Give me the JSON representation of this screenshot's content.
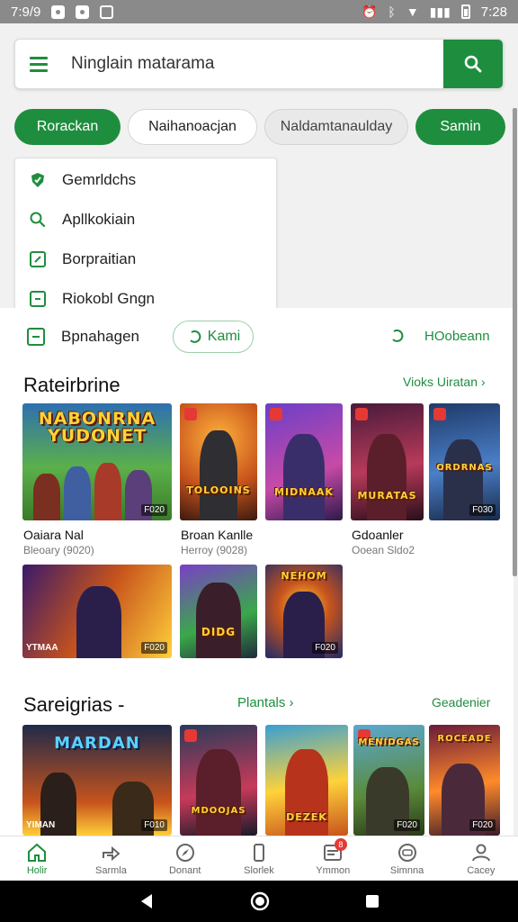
{
  "status_bar": {
    "time_left": "7:9/9",
    "time_right": "7:28"
  },
  "search": {
    "placeholder": "Ninglain matarama"
  },
  "chips": [
    {
      "label": "Rorackan",
      "style": "green"
    },
    {
      "label": "Naihanoacjan",
      "style": "outline"
    },
    {
      "label": "Naldamtanaulday",
      "style": "grey"
    },
    {
      "label": "Samin",
      "style": "green"
    }
  ],
  "dropdown": {
    "items": [
      {
        "label": "Gemrldchs",
        "icon": "shield-icon"
      },
      {
        "label": "Apllkokiain",
        "icon": "search-icon"
      },
      {
        "label": "Borpraitian",
        "icon": "edit-box-icon"
      },
      {
        "label": "Riokobl Gngn",
        "icon": "square-icon"
      }
    ]
  },
  "row1": {
    "label": "Bpnahagen",
    "pill": "Kami",
    "right_link": "HOobeann"
  },
  "section1": {
    "title": "Rateirbrine",
    "link": "Vioks Uiratan",
    "games_row1": [
      {
        "art_title": "NABONRNA\nYUDONET",
        "badge": "F020",
        "name": "Oaiara Nal",
        "sub": "Bleoary (9020)"
      },
      {
        "art_title": "TOLOOINS",
        "badge": "",
        "name": "Broan Kanlle",
        "sub": "Herroy (9028)"
      },
      {
        "art_title": "MIDNAAK",
        "badge": "",
        "name": "",
        "sub": ""
      },
      {
        "art_title": "MURATAS",
        "badge": "",
        "name": "Gdoanler",
        "sub": "Ooean Sldo2"
      },
      {
        "art_title": "ORDRNAS",
        "badge": "F030",
        "name": "",
        "sub": ""
      }
    ],
    "games_row2": [
      {
        "art_title": "",
        "badge": "F020",
        "side_text": "YTMAA"
      },
      {
        "art_title": "DIDG",
        "badge": ""
      },
      {
        "art_title": "NEHOM",
        "badge": "F020"
      }
    ]
  },
  "section2": {
    "title": "Sareigrias -",
    "link_mid": "Plantals",
    "link_right": "Geadenier",
    "games": [
      {
        "art_title": "MARDAN",
        "badge": "F010",
        "side_text": "YIMAN"
      },
      {
        "art_title": "MDOOJAS",
        "badge": ""
      },
      {
        "art_title": "DEZEK",
        "badge": ""
      },
      {
        "art_title": "MENIDGAS",
        "badge": "F020"
      },
      {
        "art_title": "ROCEADE",
        "badge": "F020"
      }
    ]
  },
  "bottom_nav": [
    {
      "label": "Holir",
      "icon": "home-icon",
      "active": true
    },
    {
      "label": "Sarmla",
      "icon": "share-icon",
      "active": false
    },
    {
      "label": "Donant",
      "icon": "compass-icon",
      "active": false
    },
    {
      "label": "Slorlek",
      "icon": "phone-icon",
      "active": false
    },
    {
      "label": "Ymmon",
      "icon": "inbox-icon",
      "active": false,
      "badge": "8"
    },
    {
      "label": "Simnna",
      "icon": "gamepad-icon",
      "active": false
    },
    {
      "label": "Cacey",
      "icon": "person-icon",
      "active": false
    }
  ],
  "colors": {
    "accent": "#1e8e3e",
    "badge": "#e53935"
  }
}
